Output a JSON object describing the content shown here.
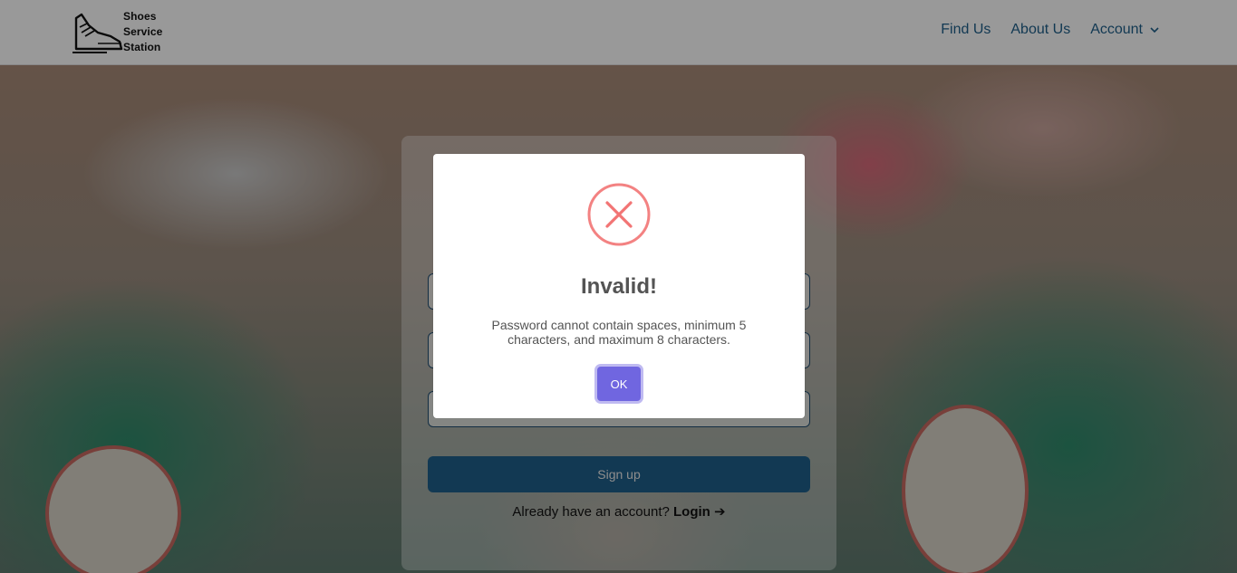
{
  "navbar": {
    "logo_text": [
      "Shoes",
      "Service",
      "Station"
    ],
    "links": {
      "find_us": "Find Us",
      "about_us": "About Us",
      "account": "Account"
    }
  },
  "signup": {
    "button_label": "Sign up",
    "login_prompt": "Already have an account?",
    "login_link": "Login",
    "login_arrow": "➔"
  },
  "dialog": {
    "title": "Invalid!",
    "message": "Password cannot contain spaces, minimum 5 characters, and maximum 8 characters.",
    "ok_label": "OK",
    "icon": "error-x-icon",
    "icon_color": "#f27474"
  },
  "colors": {
    "primary": "#1e5f8a",
    "confirm": "#7066e0"
  }
}
